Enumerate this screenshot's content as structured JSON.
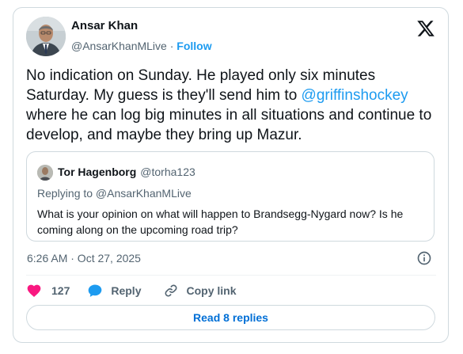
{
  "author": {
    "name": "Ansar Khan",
    "handle": "@AnsarKhanMLive",
    "separator": "·",
    "follow_label": "Follow"
  },
  "tweet": {
    "text_before": "No indication on Sunday. He played only six minutes Saturday. My guess is they'll send him to ",
    "mention": "@griffinshockey",
    "text_after": " where he can log big minutes in all situations and continue to develop, and maybe they bring up Mazur."
  },
  "quote": {
    "name": "Tor Hagenborg",
    "handle": "@torha123",
    "replying_to": "Replying to @AnsarKhanMLive",
    "text": "What is your opinion on what will happen to Brandsegg-Nygard now? Is he coming along on the upcoming road trip?"
  },
  "timestamp": "6:26 AM · Oct 27, 2025",
  "actions": {
    "like_count": "127",
    "reply_label": "Reply",
    "copy_label": "Copy link"
  },
  "read_replies_label": "Read 8 replies",
  "icons": {
    "like": "heart-icon",
    "reply": "speech-bubble-icon",
    "copy": "link-icon",
    "info": "info-icon",
    "brand": "x-logo-icon"
  },
  "colors": {
    "accent": "#1d9bf0",
    "link_button": "#006fd6",
    "like": "#f91880",
    "secondary_text": "#536471",
    "border": "#cfd9de"
  }
}
